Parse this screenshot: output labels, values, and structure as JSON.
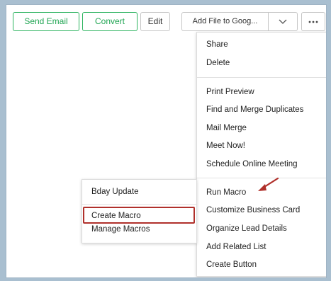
{
  "toolbar": {
    "send_email": "Send Email",
    "convert": "Convert",
    "edit": "Edit",
    "add_file": "Add File to Goog...",
    "dropdown_icon": "chevron-down-icon",
    "more_icon": "ellipsis-icon"
  },
  "main_menu": {
    "items": [
      "Share",
      "Delete",
      "Print Preview",
      "Find and Merge Duplicates",
      "Mail Merge",
      "Meet Now!",
      "Schedule Online Meeting",
      "Run Macro",
      "Customize Business Card",
      "Organize Lead Details",
      "Add Related List",
      "Create Button"
    ]
  },
  "macro_menu": {
    "items": [
      "Bday Update",
      "Create Macro",
      "Manage Macros"
    ]
  },
  "colors": {
    "accent_green": "#2cb35f",
    "highlight_red": "#b0302b",
    "background": "#a9bfd0"
  }
}
